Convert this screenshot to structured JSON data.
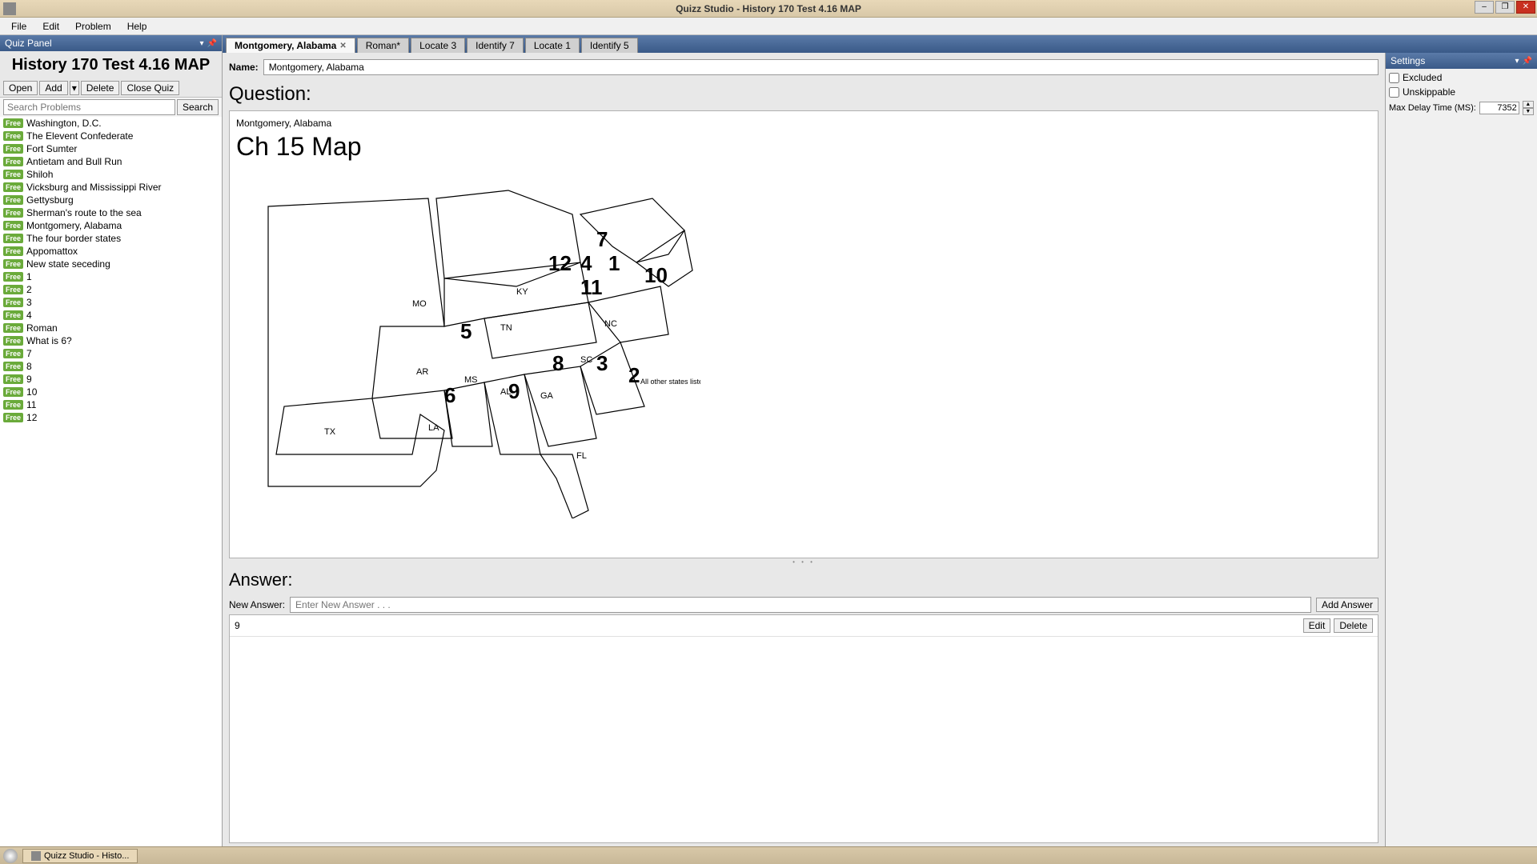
{
  "window": {
    "app_title": "Quizz Studio  - History 170 Test 4.16 MAP",
    "minimize": "–",
    "maximize": "❐",
    "close": "✕"
  },
  "menubar": [
    "File",
    "Edit",
    "Problem",
    "Help"
  ],
  "quiz_panel": {
    "header": "Quiz Panel",
    "title": "History 170 Test 4.16 MAP",
    "toolbar": {
      "open": "Open",
      "add": "Add",
      "dd": "▾",
      "delete": "Delete",
      "close_quiz": "Close Quiz"
    },
    "search_placeholder": "Search Problems",
    "search_btn": "Search",
    "badge": "Free",
    "problems": [
      "Washington, D.C.",
      "The Elevent Confederate",
      "Fort Sumter",
      "Antietam and Bull Run",
      "Shiloh",
      "Vicksburg and Mississippi River",
      "Gettysburg",
      "Sherman's route to the sea",
      "Montgomery, Alabama",
      "The four border states",
      "Appomattox",
      "New state seceding",
      "1",
      "2",
      "3",
      "4",
      "Roman",
      "What is 6?",
      "7",
      "8",
      "9",
      "10",
      "11",
      "12"
    ]
  },
  "tabs": [
    {
      "label": "Montgomery, Alabama",
      "active": true,
      "closable": true
    },
    {
      "label": "Roman*",
      "active": false,
      "closable": false
    },
    {
      "label": "Locate 3",
      "active": false,
      "closable": false
    },
    {
      "label": "Identify 7",
      "active": false,
      "closable": false
    },
    {
      "label": "Locate 1",
      "active": false,
      "closable": false
    },
    {
      "label": "Identify 5",
      "active": false,
      "closable": false
    }
  ],
  "editor": {
    "name_label": "Name:",
    "name_value": "Montgomery, Alabama",
    "question_header": "Question:",
    "question_text": "Montgomery, Alabama",
    "map_title": "Ch 15 Map",
    "map_states": {
      "MO": "MO",
      "KY": "KY",
      "TN": "TN",
      "AR": "AR",
      "MS": "MS",
      "AL": "AL",
      "GA": "GA",
      "SC": "SC",
      "NC": "NC",
      "LA": "LA",
      "TX": "TX",
      "FL": "FL"
    },
    "map_numbers": {
      "1": "1",
      "2": "2",
      "3": "3",
      "4": "4",
      "5": "5",
      "6": "6",
      "7": "7",
      "8": "8",
      "9": "9",
      "10": "10",
      "11": "11",
      "12": "12"
    },
    "map_note": "All other states listed",
    "answer_header": "Answer:",
    "new_answer_label": "New Answer:",
    "new_answer_placeholder": "Enter New Answer . . .",
    "add_answer": "Add Answer",
    "answers": [
      {
        "text": "9",
        "edit": "Edit",
        "delete": "Delete"
      }
    ]
  },
  "settings": {
    "header": "Settings",
    "excluded": "Excluded",
    "unskippable": "Unskippable",
    "max_delay_label": "Max Delay Time (MS):",
    "max_delay_value": "7352"
  },
  "taskbar": {
    "item": "Quizz Studio  - Histo..."
  }
}
